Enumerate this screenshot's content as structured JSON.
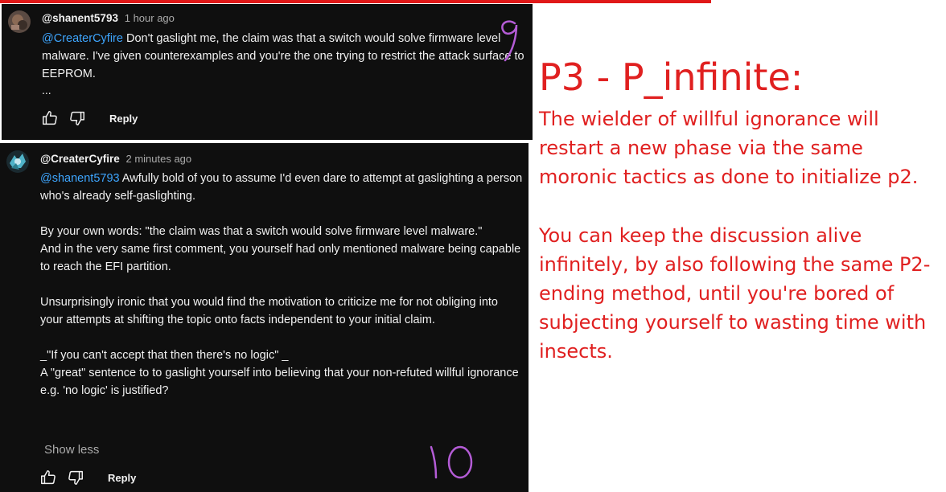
{
  "comment1": {
    "author": "@shanent5793",
    "time": "1 hour ago",
    "mention": "@CreaterCyfire",
    "text": " Don't gaslight me, the claim was that a switch would solve firmware level malware. I've given counterexamples and you're the one trying to restrict the attack surface to EEPROM.",
    "more": "...",
    "reply_label": "Reply",
    "annotation": "9"
  },
  "comment2": {
    "author": "@CreaterCyfire",
    "time": "2 minutes ago",
    "mention": "@shanent5793",
    "p1": " Awfully bold of you to assume I'd even dare to attempt at gaslighting a person who's already self-gaslighting.",
    "p2": "By your own words: \"the claim was that a switch would solve firmware level malware.\"",
    "p3": "And in the very same first comment, you yourself had only mentioned malware being capable to reach the EFI partition.",
    "p4": "Unsurprisingly ironic that you would find the motivation to criticize me for not obliging into your attempts at shifting the topic onto facts independent to your initial claim.",
    "p5": "_\"If you can't accept that then there's no logic\" _",
    "p6": "A \"great\" sentence to to gaslight yourself into believing that your non-refuted willful ignorance e.g. 'no logic' is justified?",
    "show_less": "Show less",
    "reply_label": "Reply",
    "annotation": "10"
  },
  "side": {
    "title": "P3 - P_infinite:",
    "note1": "The wielder of willful ignorance will restart a new phase via the same moronic tactics as done to initialize p2.",
    "note2": "You can keep the discussion alive infinitely, by also following the same P2-ending method, until you're bored of subjecting yourself to wasting time with insects."
  },
  "colors": {
    "panel_bg": "#0f0f0f",
    "mention": "#3ea6ff",
    "accent_red": "#e02020",
    "annotation_purple": "#b45cd6"
  }
}
